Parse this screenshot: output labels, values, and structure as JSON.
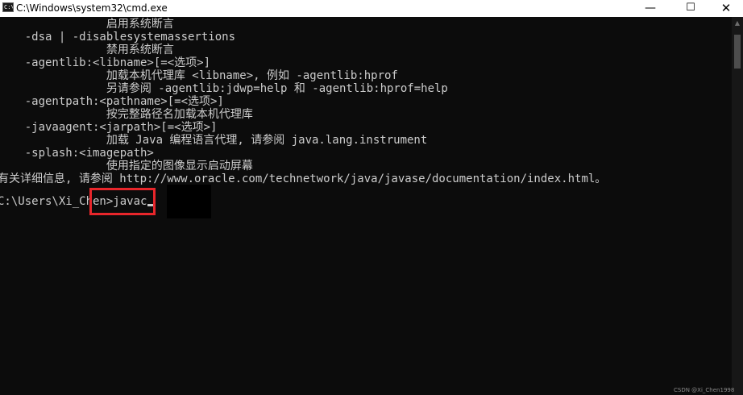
{
  "window": {
    "title": "C:\\Windows\\system32\\cmd.exe",
    "icon_label": "C:\\",
    "minimize_glyph": "—",
    "maximize_glyph": "☐",
    "close_glyph": "✕"
  },
  "console": {
    "lines": [
      "                启用系统断言",
      "    -dsa | -disablesystemassertions",
      "                禁用系统断言",
      "    -agentlib:<libname>[=<选项>]",
      "                加载本机代理库 <libname>, 例如 -agentlib:hprof",
      "                另请参阅 -agentlib:jdwp=help 和 -agentlib:hprof=help",
      "    -agentpath:<pathname>[=<选项>]",
      "                按完整路径名加载本机代理库",
      "    -javaagent:<jarpath>[=<选项>]",
      "                加载 Java 编程语言代理, 请参阅 java.lang.instrument",
      "    -splash:<imagepath>",
      "                使用指定的图像显示启动屏幕",
      "有关详细信息, 请参阅 http://www.oracle.com/technetwork/java/javase/documentation/index.html。"
    ],
    "prompt": "C:\\Users\\Xi_Chen>",
    "command": "javac"
  },
  "scrollbar": {
    "up_glyph": "▲"
  },
  "watermark": "CSDN @Xi_Chen1998"
}
